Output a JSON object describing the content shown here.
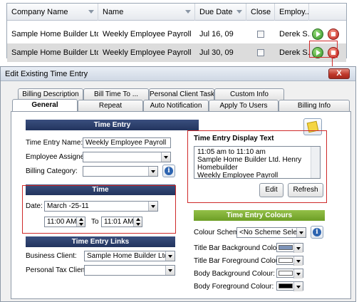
{
  "grid": {
    "columns": [
      "Company Name",
      "Name",
      "Due Date",
      "Close",
      "Employ..."
    ],
    "rows": [
      {
        "company": "Sample Home Builder Ltd.",
        "name": "Weekly Employee Payroll",
        "due": "Jul 16, 09",
        "employee": "Derek S..."
      },
      {
        "company": "Sample Home Builder Ltd.",
        "name": "Weekly Employee Payroll",
        "due": "Jul 30, 09",
        "employee": "Derek S..."
      }
    ]
  },
  "dialog": {
    "title": "Edit Existing Time Entry",
    "close_label": "X",
    "tabs_back": [
      "Billing Description",
      "Bill Time To ...",
      "Personal Client Task",
      "Custom Info"
    ],
    "tabs_front": [
      "General",
      "Repeat",
      "Auto Notification",
      "Apply To Users",
      "Billing Info"
    ]
  },
  "time_entry": {
    "header": "Time Entry",
    "name_label": "Time Entry Name:",
    "name_value": "Weekly Employee Payroll",
    "employee_label": "Employee Assigned:",
    "employee_value": "",
    "billing_label": "Billing Category:",
    "billing_value": ""
  },
  "display_text": {
    "header": "Time Entry Display Text",
    "lines": [
      "11:05 am to 11:10 am",
      "  Sample Home Builder Ltd. Henry",
      "Homebuilder",
      "Weekly Employee Payroll"
    ],
    "edit_label": "Edit",
    "refresh_label": "Refresh"
  },
  "time": {
    "header": "Time",
    "date_label": "Date:",
    "date_value": "March   -25-11",
    "start_value": "11:00 AM",
    "to_label": "To",
    "end_value": "11:01 AM"
  },
  "links": {
    "header": "Time Entry Links",
    "business_label": "Business Client:",
    "business_value": "Sample Home Builder Ltd.",
    "personal_label": "Personal Tax Client:",
    "personal_value": ""
  },
  "colours": {
    "header": "Time Entry Colours",
    "scheme_label": "Colour Scheme:",
    "scheme_value": "<No Scheme Selected>",
    "rows": [
      {
        "label": "Title Bar Background Colour:",
        "color": "#7d93b8"
      },
      {
        "label": "Title Bar Foreground Colour:",
        "color": "#ffffff"
      },
      {
        "label": "Body Background Colour:",
        "color": "#ffffff"
      },
      {
        "label": "Body Foreground Colour:",
        "color": "#000000"
      }
    ]
  },
  "accent": {
    "navy": "#2b3d69",
    "green": "#7cab33",
    "highlight": "#cf2a2a"
  }
}
